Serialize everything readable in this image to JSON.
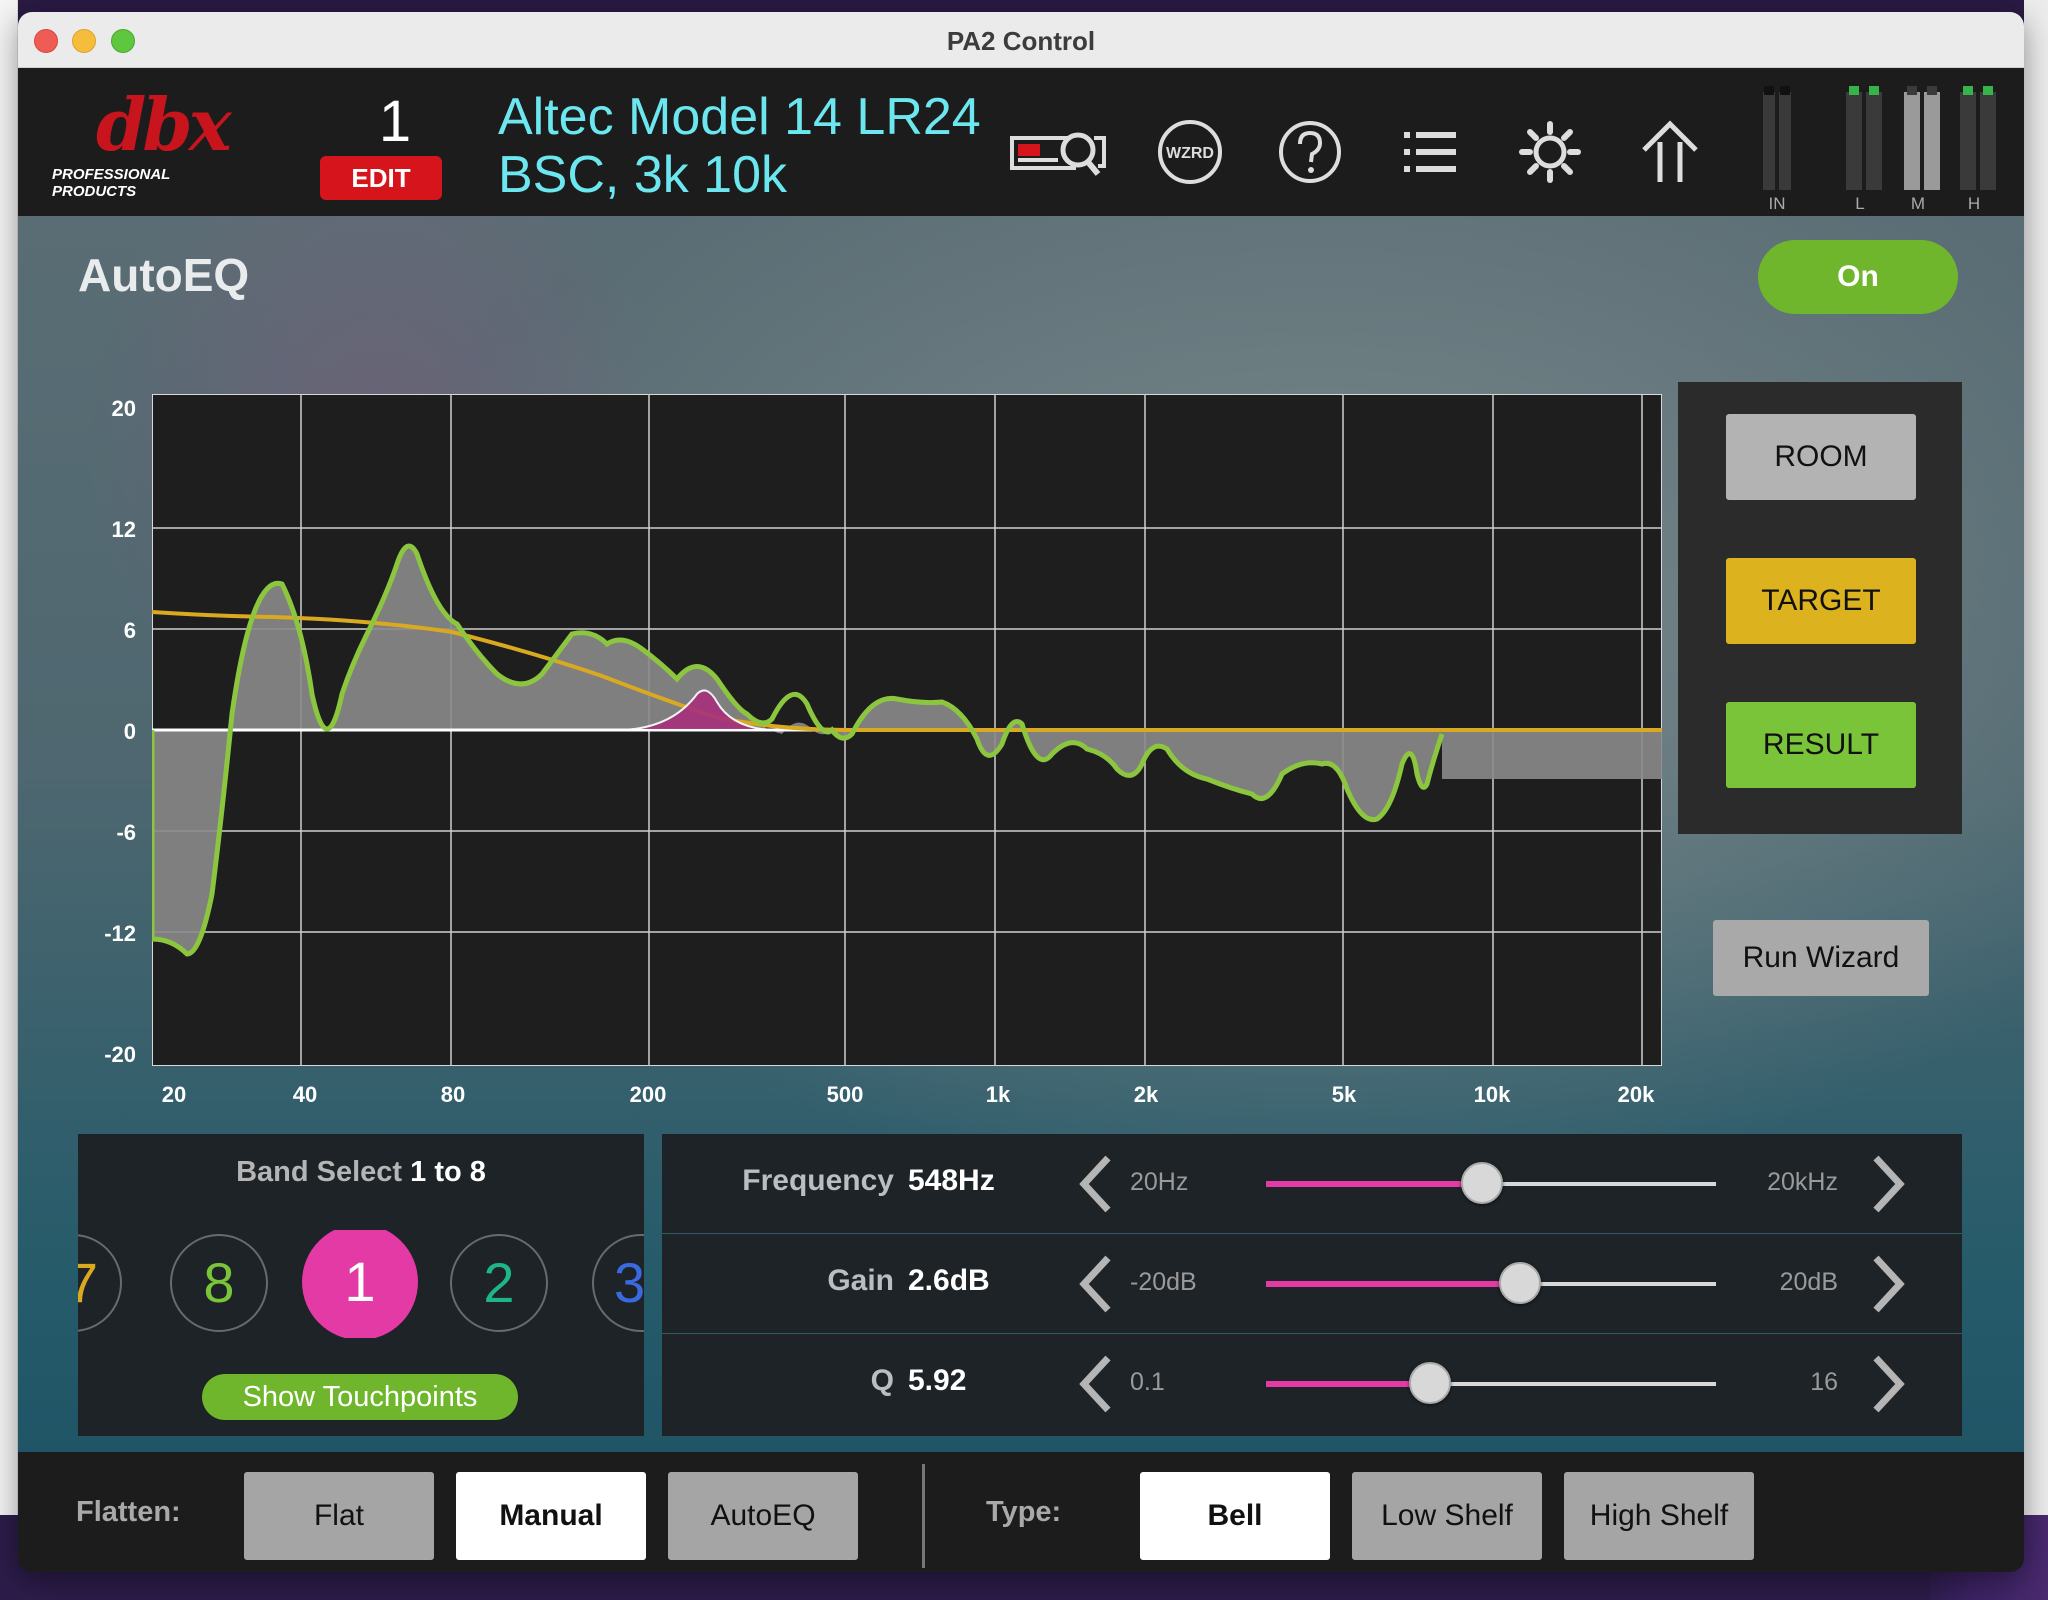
{
  "window": {
    "title": "PA2 Control"
  },
  "header": {
    "logo_text": "dbx",
    "logo_subtext": "PROFESSIONAL PRODUCTS",
    "preset_number": "1",
    "edit_label": "EDIT",
    "preset_name_line1": "Altec Model 14 LR24",
    "preset_name_line2": "BSC, 3k 10k",
    "icons": [
      "device-search-icon",
      "wizard-icon",
      "help-icon",
      "list-icon",
      "settings-icon",
      "home-icon"
    ],
    "wizard_icon_text": "WZRD",
    "meters": {
      "labels": [
        "IN",
        "L",
        "M",
        "H"
      ]
    }
  },
  "page": {
    "title": "AutoEQ",
    "on_toggle_label": "On"
  },
  "graph": {
    "y_ticks": [
      "20",
      "12",
      "6",
      "0",
      "-6",
      "-12",
      "-20"
    ],
    "x_ticks": [
      "20",
      "40",
      "80",
      "200",
      "500",
      "1k",
      "2k",
      "5k",
      "10k",
      "20k"
    ]
  },
  "side_panel": {
    "room_label": "ROOM",
    "target_label": "TARGET",
    "result_label": "RESULT",
    "run_wizard_label": "Run Wizard",
    "colors": {
      "room": "#b3b3b3",
      "target": "#dcb21f",
      "result": "#7ac43a"
    }
  },
  "band_select": {
    "title_prefix": "Band Select",
    "title_range": "1 to 8",
    "visible_bands": [
      "7",
      "8",
      "1",
      "2",
      "3"
    ],
    "selected_band": "1",
    "show_touchpoints_label": "Show Touchpoints"
  },
  "params": {
    "frequency": {
      "label": "Frequency",
      "value": "548Hz",
      "min": "20Hz",
      "max": "20kHz",
      "position": 0.48
    },
    "gain": {
      "label": "Gain",
      "value": "2.6dB",
      "min": "-20dB",
      "max": "20dB",
      "position": 0.565
    },
    "q": {
      "label": "Q",
      "value": "5.92",
      "min": "0.1",
      "max": "16",
      "position": 0.365
    }
  },
  "footer": {
    "flatten_label": "Flatten:",
    "flatten_options": [
      "Flat",
      "Manual",
      "AutoEQ"
    ],
    "flatten_selected": "Manual",
    "type_label": "Type:",
    "type_options": [
      "Bell",
      "Low Shelf",
      "High Shelf"
    ],
    "type_selected": "Bell"
  },
  "colors": {
    "accent_pink": "#e33aa5",
    "accent_green": "#6fb62d",
    "edit_red": "#d5141c",
    "preset_cyan": "#6ce7f0"
  }
}
